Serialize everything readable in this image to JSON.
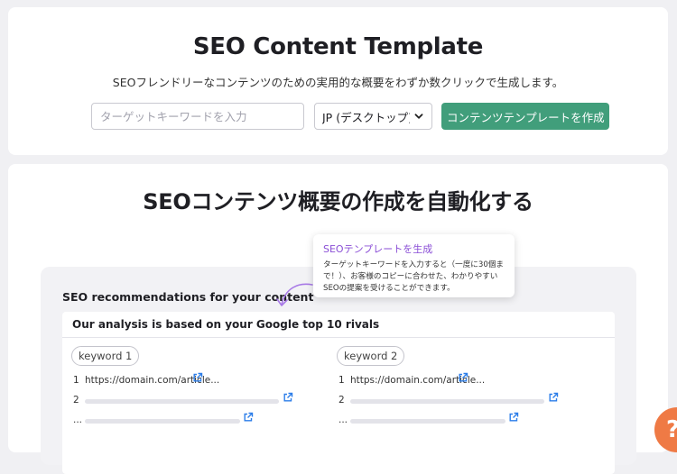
{
  "hero": {
    "title": "SEO Content Template",
    "subtitle": "SEOフレンドリーなコンテンツのための実用的な概要をわずか数クリックで生成します。",
    "keyword_placeholder": "ターゲットキーワードを入力",
    "database_value": "JP (デスクトップ)",
    "create_label": "コンテンツテンプレートを作成"
  },
  "feature": {
    "title": "SEOコンテンツ概要の作成を自動化する",
    "recommendations_heading": "SEO recommendations for your content",
    "rivals_heading": "Our analysis is based on your Google top 10 rivals",
    "columns": [
      {
        "keyword": "keyword 1",
        "rows": [
          {
            "num": "1",
            "url": "https://domain.com/article..."
          },
          {
            "num": "2",
            "url": ""
          },
          {
            "num": "...",
            "url": ""
          }
        ]
      },
      {
        "keyword": "keyword 2",
        "rows": [
          {
            "num": "1",
            "url": "https://domain.com/article..."
          },
          {
            "num": "2",
            "url": ""
          },
          {
            "num": "...",
            "url": ""
          }
        ]
      }
    ]
  },
  "tooltip": {
    "title": "SEOテンプレートを生成",
    "body": "ターゲットキーワードを入力すると（一度に30個まで！）、お客様のコピーに合わせた、わかりやすいSEOの提案を受けることができます。"
  },
  "help": {
    "label": "?"
  },
  "colors": {
    "accent_green": "#419e7b",
    "tooltip_purple": "#8a4ed6",
    "link_blue": "#2b7de9",
    "help_orange": "#ef7a45"
  },
  "icons": {
    "chevron": "chevron-down-icon",
    "external": "external-link-icon",
    "arrow": "curved-arrow-icon"
  }
}
